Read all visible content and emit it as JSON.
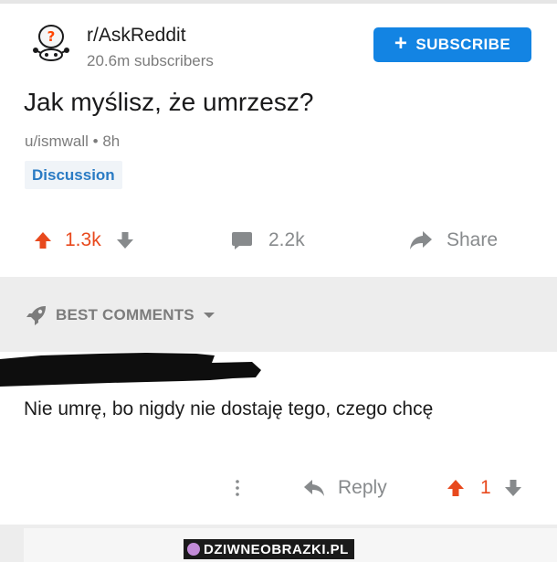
{
  "subreddit": {
    "name": "r/AskReddit",
    "subscribers": "20.6m subscribers",
    "subscribe_label": "SUBSCRIBE"
  },
  "post": {
    "title": "Jak myślisz, że umrzesz?",
    "author": "u/ismwall",
    "separator": "•",
    "age": "8h",
    "flair": "Discussion",
    "score": "1.3k",
    "comments": "2.2k",
    "share_label": "Share"
  },
  "sort": {
    "label": "BEST COMMENTS"
  },
  "comment": {
    "body": "Nie umrę, bo nigdy nie dostaję tego, czego chcę",
    "reply_label": "Reply",
    "score": "1"
  },
  "watermark": {
    "text": "DZIWNEOBRAZKI.PL"
  },
  "colors": {
    "accent_blue": "#1384e3",
    "upvote_orange": "#e8491d",
    "flair_blue": "#2a7bc4",
    "muted_gray": "#7c7c7c"
  }
}
